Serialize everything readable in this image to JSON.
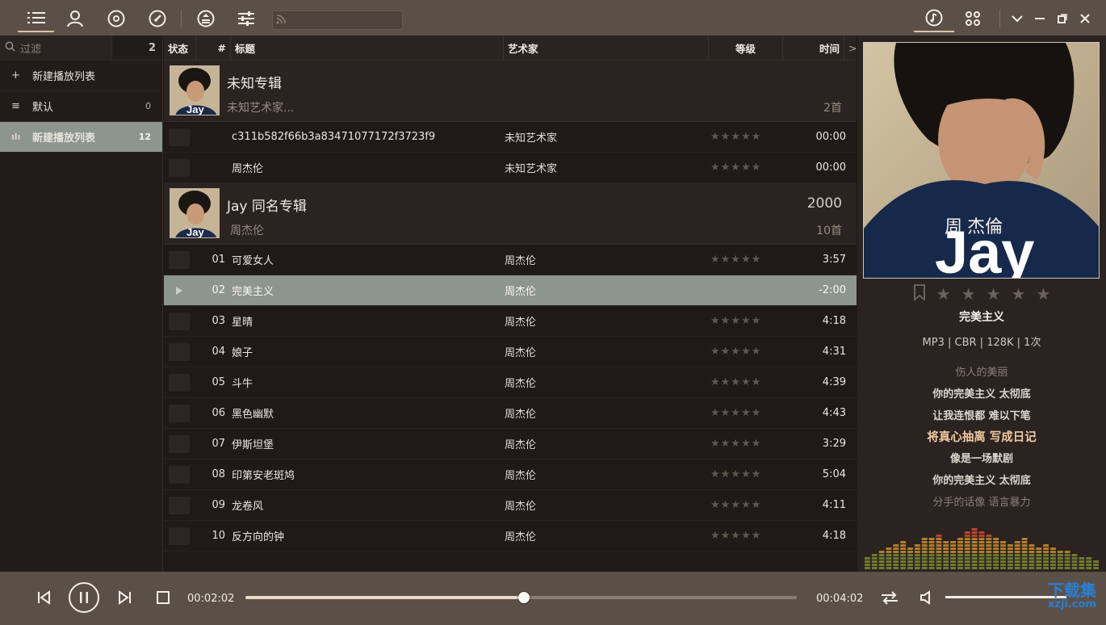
{
  "top_bar": {
    "icons": [
      "playlist-icon",
      "artist-icon",
      "album-icon",
      "genre-icon",
      "equalizer-icon",
      "settings-sliders-icon"
    ],
    "search_placeholder": "",
    "right_icons": [
      "music-note-icon",
      "grid-icon",
      "chevron-down-icon",
      "minimize-icon",
      "restore-icon",
      "close-icon"
    ]
  },
  "sidebar": {
    "filter_placeholder": "过滤",
    "filter_count": "2",
    "items": [
      {
        "label": "新建播放列表",
        "count": "",
        "icon": "+"
      },
      {
        "label": "默认",
        "count": "0",
        "icon": "≡"
      },
      {
        "label": "新建播放列表",
        "count": "12",
        "icon": "ılı"
      }
    ]
  },
  "columns": {
    "status": "状态",
    "num": "#",
    "title": "标题",
    "artist": "艺术家",
    "rating": "等级",
    "time": "时间",
    "more": ">"
  },
  "albums": [
    {
      "title": "未知专辑",
      "artist": "未知艺术家...",
      "year": "",
      "count": "2首",
      "tracks": [
        {
          "num": "",
          "title": "c311b582f66b3a83471077172f3723f9",
          "artist": "未知艺术家",
          "stars": "★★★★★",
          "time": "00:00"
        },
        {
          "num": "",
          "title": "周杰伦",
          "artist": "未知艺术家",
          "stars": "★★★★★",
          "time": "00:00"
        }
      ]
    },
    {
      "title": "Jay 同名专辑",
      "artist": "周杰伦",
      "year": "2000",
      "count": "10首",
      "tracks": [
        {
          "num": "01",
          "title": "可爱女人",
          "artist": "周杰伦",
          "stars": "★★★★★",
          "time": "3:57"
        },
        {
          "num": "02",
          "title": "完美主义",
          "artist": "周杰伦",
          "stars": "",
          "time": "-2:00",
          "playing": true
        },
        {
          "num": "03",
          "title": "星晴",
          "artist": "周杰伦",
          "stars": "★★★★★",
          "time": "4:18"
        },
        {
          "num": "04",
          "title": "娘子",
          "artist": "周杰伦",
          "stars": "★★★★★",
          "time": "4:31"
        },
        {
          "num": "05",
          "title": "斗牛",
          "artist": "周杰伦",
          "stars": "★★★★★",
          "time": "4:39"
        },
        {
          "num": "06",
          "title": "黑色幽默",
          "artist": "周杰伦",
          "stars": "★★★★★",
          "time": "4:43"
        },
        {
          "num": "07",
          "title": "伊斯坦堡",
          "artist": "周杰伦",
          "stars": "★★★★★",
          "time": "3:29"
        },
        {
          "num": "08",
          "title": "印第安老斑鸠",
          "artist": "周杰伦",
          "stars": "★★★★★",
          "time": "5:04"
        },
        {
          "num": "09",
          "title": "龙卷风",
          "artist": "周杰伦",
          "stars": "★★★★★",
          "time": "4:11"
        },
        {
          "num": "10",
          "title": "反方向的钟",
          "artist": "周杰伦",
          "stars": "★★★★★",
          "time": "4:18"
        }
      ]
    }
  ],
  "now_playing": {
    "cover_text_big": "Jay",
    "cover_text_cn": "周 杰倫",
    "title": "完美主义",
    "meta": "MP3 | CBR | 128K | 1次",
    "rating_icons": [
      "bookmark-icon",
      "star-icon",
      "star-icon",
      "star-icon",
      "star-icon",
      "star-icon"
    ],
    "lyrics": [
      {
        "text": "伤人的美丽",
        "style": "dim"
      },
      {
        "text": "你的完美主义 太彻底",
        "style": ""
      },
      {
        "text": "让我连恨都 难以下笔",
        "style": ""
      },
      {
        "text": "将真心抽离 写成日记",
        "style": "cur"
      },
      {
        "text": "像是一场默剧",
        "style": ""
      },
      {
        "text": "你的完美主义 太彻底",
        "style": ""
      },
      {
        "text": "分手的话像 语言暴力",
        "style": "dim"
      }
    ]
  },
  "player": {
    "current_time": "00:02:02",
    "total_time": "00:04:02",
    "progress": 0.505,
    "volume": 0.85
  },
  "watermark": {
    "line1": "下载集",
    "line2": "xzji.com"
  }
}
